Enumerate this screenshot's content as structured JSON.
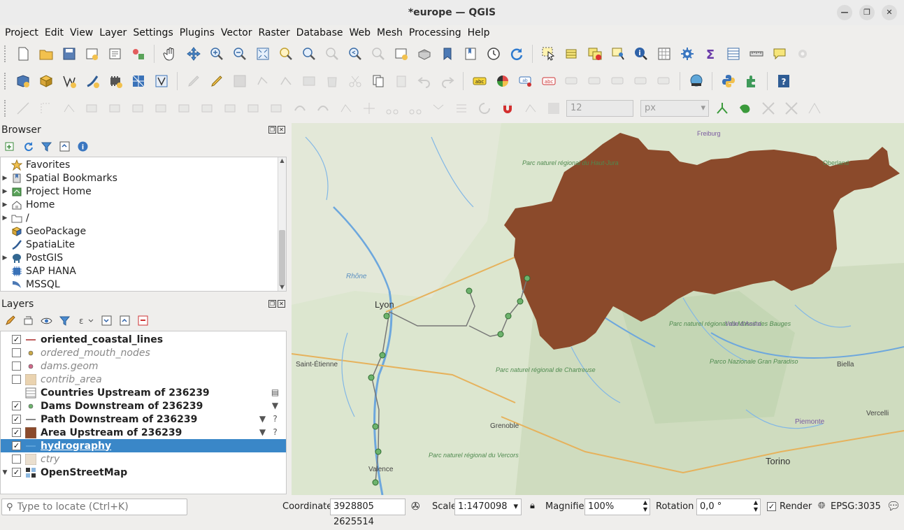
{
  "window": {
    "title": "*europe — QGIS"
  },
  "menubar": [
    "Project",
    "Edit",
    "View",
    "Layer",
    "Settings",
    "Plugins",
    "Vector",
    "Raster",
    "Database",
    "Web",
    "Mesh",
    "Processing",
    "Help"
  ],
  "menu_underline": [
    "P",
    "E",
    "V",
    "L",
    "S",
    "P",
    "V",
    "R",
    "D",
    "W",
    "M",
    "o",
    "H"
  ],
  "toolbar3": {
    "size_value": "12",
    "unit_value": "px"
  },
  "browser": {
    "title": "Browser",
    "items": [
      {
        "label": "Favorites",
        "icon": "star-icon",
        "arrow": false
      },
      {
        "label": "Spatial Bookmarks",
        "icon": "bookmark-icon",
        "arrow": true
      },
      {
        "label": "Project Home",
        "icon": "project-home-icon",
        "arrow": true
      },
      {
        "label": "Home",
        "icon": "home-icon",
        "arrow": true
      },
      {
        "label": "/",
        "icon": "folder-icon",
        "arrow": true
      },
      {
        "label": "GeoPackage",
        "icon": "geopackage-icon",
        "arrow": false
      },
      {
        "label": "SpatiaLite",
        "icon": "spatialite-icon",
        "arrow": false
      },
      {
        "label": "PostGIS",
        "icon": "postgis-icon",
        "arrow": true
      },
      {
        "label": "SAP HANA",
        "icon": "sap-hana-icon",
        "arrow": false
      },
      {
        "label": "MSSQL",
        "icon": "mssql-icon",
        "arrow": false
      }
    ]
  },
  "layers": {
    "title": "Layers",
    "items": [
      {
        "label": "oriented_coastal_lines",
        "checked": true,
        "style": "bold",
        "symbol": "line",
        "color": "#c06060"
      },
      {
        "label": "ordered_mouth_nodes",
        "checked": false,
        "style": "dim",
        "symbol": "point",
        "color": "#c9a848"
      },
      {
        "label": "dams.geom",
        "checked": false,
        "style": "dim",
        "symbol": "point",
        "color": "#d06a8a"
      },
      {
        "label": "contrib_area",
        "checked": false,
        "style": "dim",
        "symbol": "fill",
        "color": "#ead3b0"
      },
      {
        "label": "Countries Upstream of 236239",
        "checked": null,
        "style": "bold",
        "symbol": "table",
        "color": "#888888"
      },
      {
        "label": "Dams Downstream of 236239",
        "checked": true,
        "style": "bold",
        "symbol": "point",
        "color": "#6db36d"
      },
      {
        "label": "Path Downstream of 236239",
        "checked": true,
        "style": "bold",
        "symbol": "line",
        "color": "#888888"
      },
      {
        "label": "Area Upstream of 236239",
        "checked": true,
        "style": "bold",
        "symbol": "fill",
        "color": "#8b4a2b"
      },
      {
        "label": "hydrography",
        "checked": true,
        "style": "selected",
        "symbol": "line",
        "color": "#5aa0d8"
      },
      {
        "label": "ctry",
        "checked": false,
        "style": "dim",
        "symbol": "fill",
        "color": "#eadfcf"
      },
      {
        "label": "OpenStreetMap",
        "checked": true,
        "style": "bold",
        "symbol": "raster",
        "color": "#333333"
      }
    ]
  },
  "map_labels": [
    "Lyon",
    "Saint-Étienne",
    "Grenoble",
    "Valence",
    "Torino",
    "Biella",
    "Vercelli",
    "Piemonte",
    "Freiburg",
    "Parc naturel régional du Haut-Jura",
    "Parc naturel régional de Chartreuse",
    "Parc naturel régional du Vercors",
    "Parc naturel régional du Massif des Bauges",
    "Parco Nazionale Gran Paradiso",
    "Rhône",
    "Valle d'Aosta",
    "Oberland"
  ],
  "statusbar": {
    "locate_placeholder": "Type to locate (Ctrl+K)",
    "coordinate_label": "Coordinate",
    "coordinate_value": "3928805 2625514",
    "scale_label": "Scale",
    "scale_value": "1:1470098",
    "magnifier_label": "Magnifier",
    "magnifier_value": "100%",
    "rotation_label": "Rotation",
    "rotation_value": "0,0 °",
    "render_label": "Render",
    "crs_label": "EPSG:3035"
  },
  "colors": {
    "selection": "#3a87c8",
    "area_fill": "#8b4a2b",
    "river": "#4d9ad6",
    "map_bg": "#dfe8d2"
  }
}
